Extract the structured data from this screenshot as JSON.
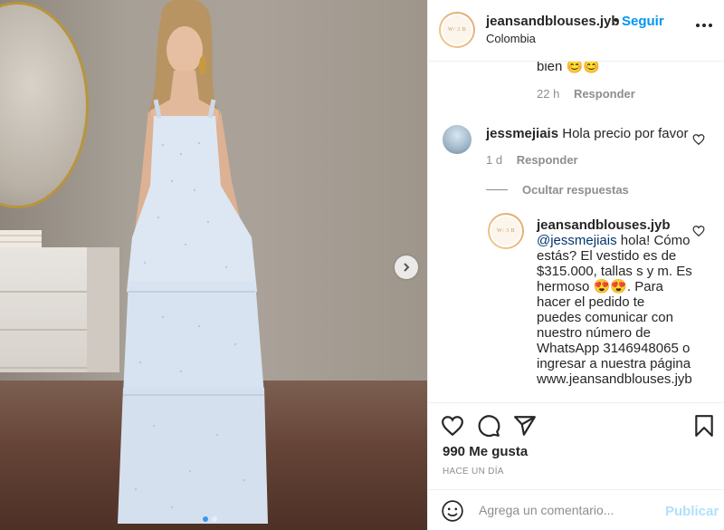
{
  "post": {
    "author": "jeansandblouses.jyb",
    "location": "Colombia",
    "follow_label": "Seguir",
    "separator": "•",
    "avatar_text": "W/ 3 B"
  },
  "comments": {
    "prev_tail": {
      "text": "bien 😊😊",
      "time": "22 h",
      "reply_label": "Responder"
    },
    "comment": {
      "user": "jessmejiais",
      "text": "Hola precio por favor",
      "time": "1 d",
      "reply_label": "Responder"
    },
    "hide_replies_label": "Ocultar respuestas",
    "reply": {
      "user": "jeansandblouses.jyb",
      "mention": "@jessmejiais",
      "text": " hola! Cómo estás? El vestido es de $315.000, tallas s y m. Es hermoso 😍😍. Para hacer el pedido te puedes comunicar con nuestro número de WhatsApp 3146948065 o ingresar a nuestra página www.jeansandblouses.jyb"
    }
  },
  "actions": {
    "likes": "990 Me gusta",
    "posted_ago": "HACE UN DÍA",
    "icons": [
      "heart-icon",
      "comment-icon",
      "share-icon",
      "bookmark-icon"
    ]
  },
  "composer": {
    "placeholder": "Agrega un comentario...",
    "publish_label": "Publicar"
  },
  "carousel": {
    "slides": 2,
    "active": 1
  },
  "colors": {
    "accent": "#0095f6",
    "publish_disabled": "#b2dffc",
    "muted": "#8e8e8e"
  }
}
